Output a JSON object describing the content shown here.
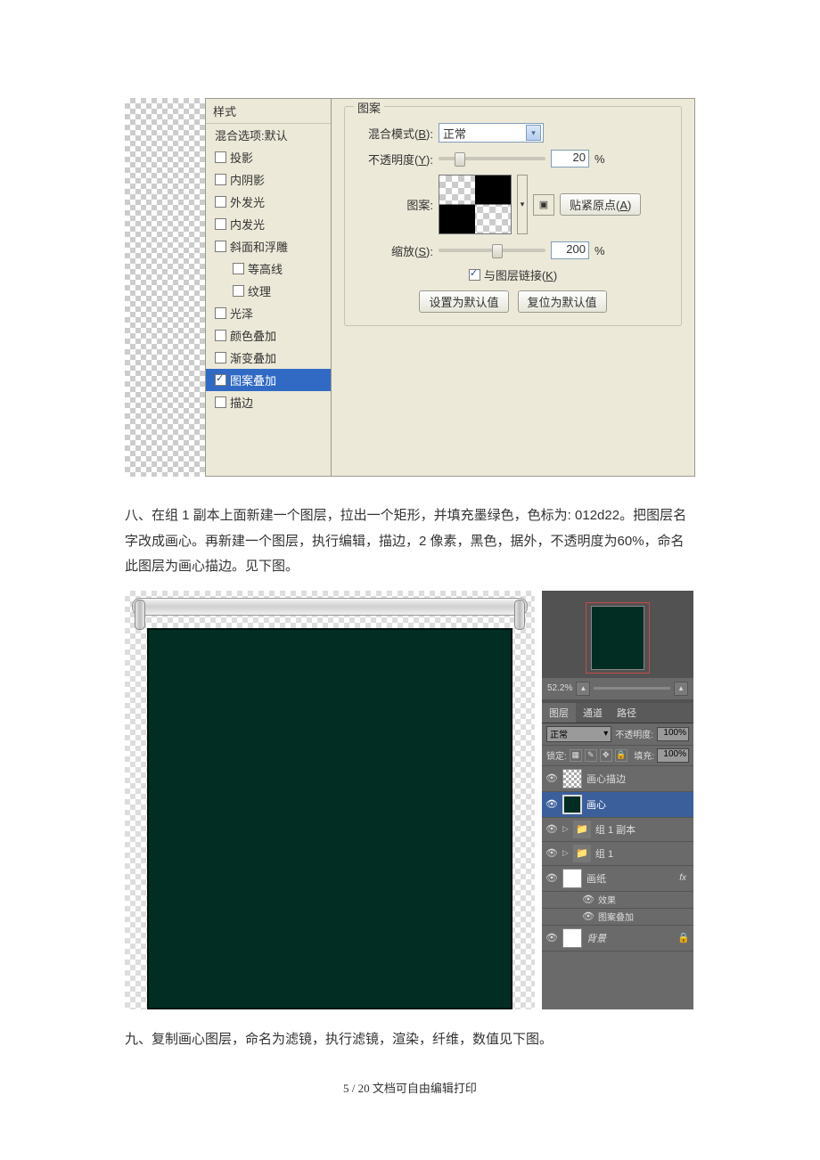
{
  "fig1": {
    "sidebar": {
      "header": "样式",
      "blend_default": "混合选项:默认",
      "items": [
        "投影",
        "内阴影",
        "外发光",
        "内发光",
        "斜面和浮雕",
        "等高线",
        "纹理",
        "光泽",
        "颜色叠加",
        "渐变叠加",
        "图案叠加",
        "描边"
      ]
    },
    "panel": {
      "group_title": "图案",
      "blend_mode_label": "混合模式(B):",
      "blend_mode_value": "正常",
      "opacity_label": "不透明度(Y):",
      "opacity_value": "20",
      "percent": "%",
      "pattern_label": "图案:",
      "snap_label": "贴紧原点(A)",
      "scale_label": "缩放(S):",
      "scale_value": "200",
      "link_label": "与图层链接(K)",
      "default_btn": "设置为默认值",
      "reset_btn": "复位为默认值"
    }
  },
  "para1": "八、在组 1 副本上面新建一个图层，拉出一个矩形，并填充墨绿色，色标为: 012d22。把图层名字改成画心。再新建一个图层，执行编辑，描边，2 像素，黑色，据外，不透明度为60%，命名此图层为画心描边。见下图。",
  "fig2": {
    "zoom": "52.2%",
    "tabs": [
      "图层",
      "通道",
      "路径"
    ],
    "mode": "正常",
    "opacity_label": "不透明度:",
    "opacity_value": "100%",
    "lock_label": "锁定:",
    "fill_label": "填充:",
    "fill_value": "100%",
    "layers": [
      {
        "name": "画心描边",
        "thumb": "checker"
      },
      {
        "name": "画心",
        "thumb": "green",
        "selected": true
      },
      {
        "name": "组 1 副本",
        "folder": true,
        "tri": true
      },
      {
        "name": "组 1",
        "folder": true,
        "tri": true
      },
      {
        "name": "画纸",
        "thumb": "white",
        "fx": true
      },
      {
        "name": "背景",
        "thumb": "white",
        "italic": true,
        "lock": true
      }
    ],
    "fx_label": "效果",
    "fx_item": "图案叠加",
    "fx_badge": "fx"
  },
  "para2": "九、复制画心图层，命名为滤镜，执行滤镜，渲染，纤维，数值见下图。",
  "footer": {
    "page": "5 / 20",
    "note": "文档可自由编辑打印"
  }
}
